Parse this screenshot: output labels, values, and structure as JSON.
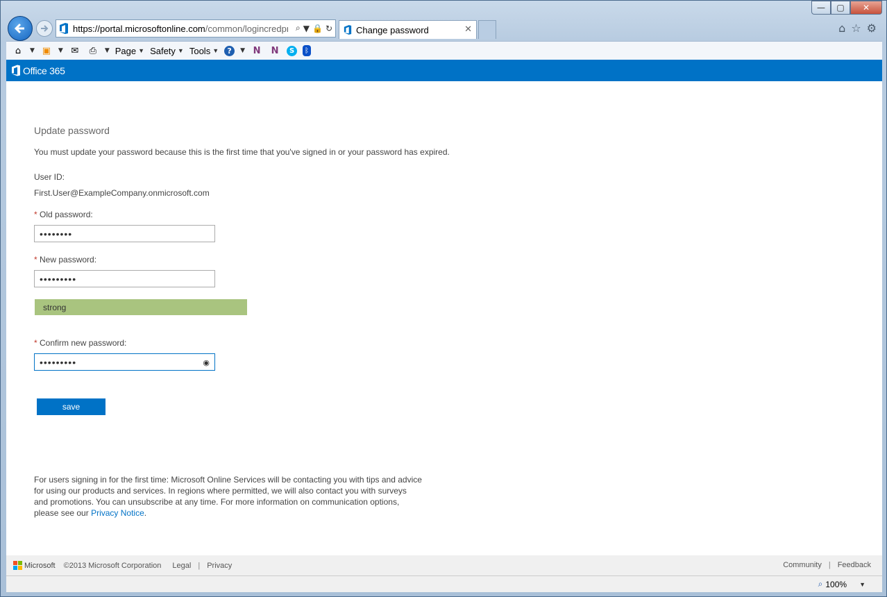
{
  "browser": {
    "url_main": "https://portal.",
    "url_domain": "microsoftonline.com",
    "url_path": "/common/logincredpr",
    "tab_label": "Change password",
    "tab_close": "✕",
    "window_controls": {
      "minimize": "—",
      "maximize": "▢",
      "close": "✕"
    },
    "command_bar": {
      "page": "Page",
      "safety": "Safety",
      "tools": "Tools"
    },
    "zoom": "100%"
  },
  "app": {
    "brand": "Office 365"
  },
  "form": {
    "title": "Update password",
    "intro": "You must update your password because this is the first time that you've signed in or your password has expired.",
    "user_id_label": "User ID:",
    "user_id_value": "First.User@ExampleCompany.onmicrosoft.com",
    "required_marker": "*",
    "old_password_label": "Old password:",
    "old_password_value": "••••••••",
    "new_password_label": "New password:",
    "new_password_value": "•••••••••",
    "strength_label": "strong",
    "confirm_password_label": "Confirm new password:",
    "confirm_password_value": "•••••••••",
    "save_label": "save"
  },
  "notice": {
    "text": "For users signing in for the first time: Microsoft Online Services will be contacting you with tips and advice for using our products and services. In regions where permitted, we will also contact you with surveys and promotions. You can unsubscribe at any time. For more information on communication options, please see our ",
    "link": "Privacy Notice",
    "end": "."
  },
  "footer": {
    "ms_name": "Microsoft",
    "copyright": "©2013 Microsoft Corporation",
    "legal": "Legal",
    "privacy": "Privacy",
    "community": "Community",
    "feedback": "Feedback",
    "separator": "|"
  },
  "colors": {
    "brand_blue": "#0072c6",
    "strength_green": "#a9c47f"
  }
}
